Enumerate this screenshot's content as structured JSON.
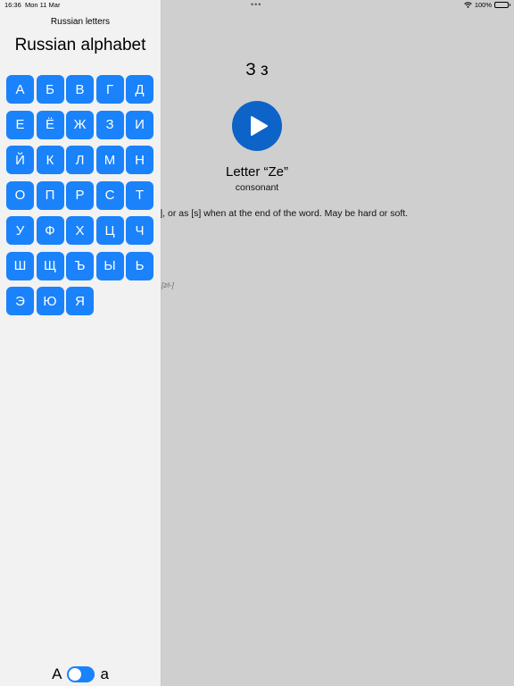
{
  "status_bar": {
    "time": "16:36",
    "date": "Mon 11 Mar",
    "battery": "100%",
    "battery_level": 1.0
  },
  "sidebar": {
    "nav_title": "Russian letters",
    "large_title": "Russian alphabet",
    "letters": [
      "А",
      "Б",
      "В",
      "Г",
      "Д",
      "Е",
      "Ё",
      "Ж",
      "З",
      "И",
      "Й",
      "К",
      "Л",
      "М",
      "Н",
      "О",
      "П",
      "Р",
      "С",
      "Т",
      "У",
      "Ф",
      "Х",
      "Ц",
      "Ч",
      "Ш",
      "Щ",
      "Ъ",
      "Ы",
      "Ь",
      "Э",
      "Ю",
      "Я"
    ],
    "case_toggle": {
      "upper_label": "А",
      "lower_label": "а",
      "is_on": false
    }
  },
  "detail": {
    "letter_pair": "З з",
    "play_icon": "play-icon",
    "letter_name": "Letter “Ze”",
    "letter_type": "consonant",
    "description_visible": "z], or as [s] when at the end of the word. May be hard or soft.",
    "ipa_visible": "[zʲi-]"
  },
  "colors": {
    "accent": "#1a82fb",
    "play_button": "#0d63c7",
    "sidebar_bg": "#f2f2f2",
    "detail_bg": "#cfcfcf"
  }
}
